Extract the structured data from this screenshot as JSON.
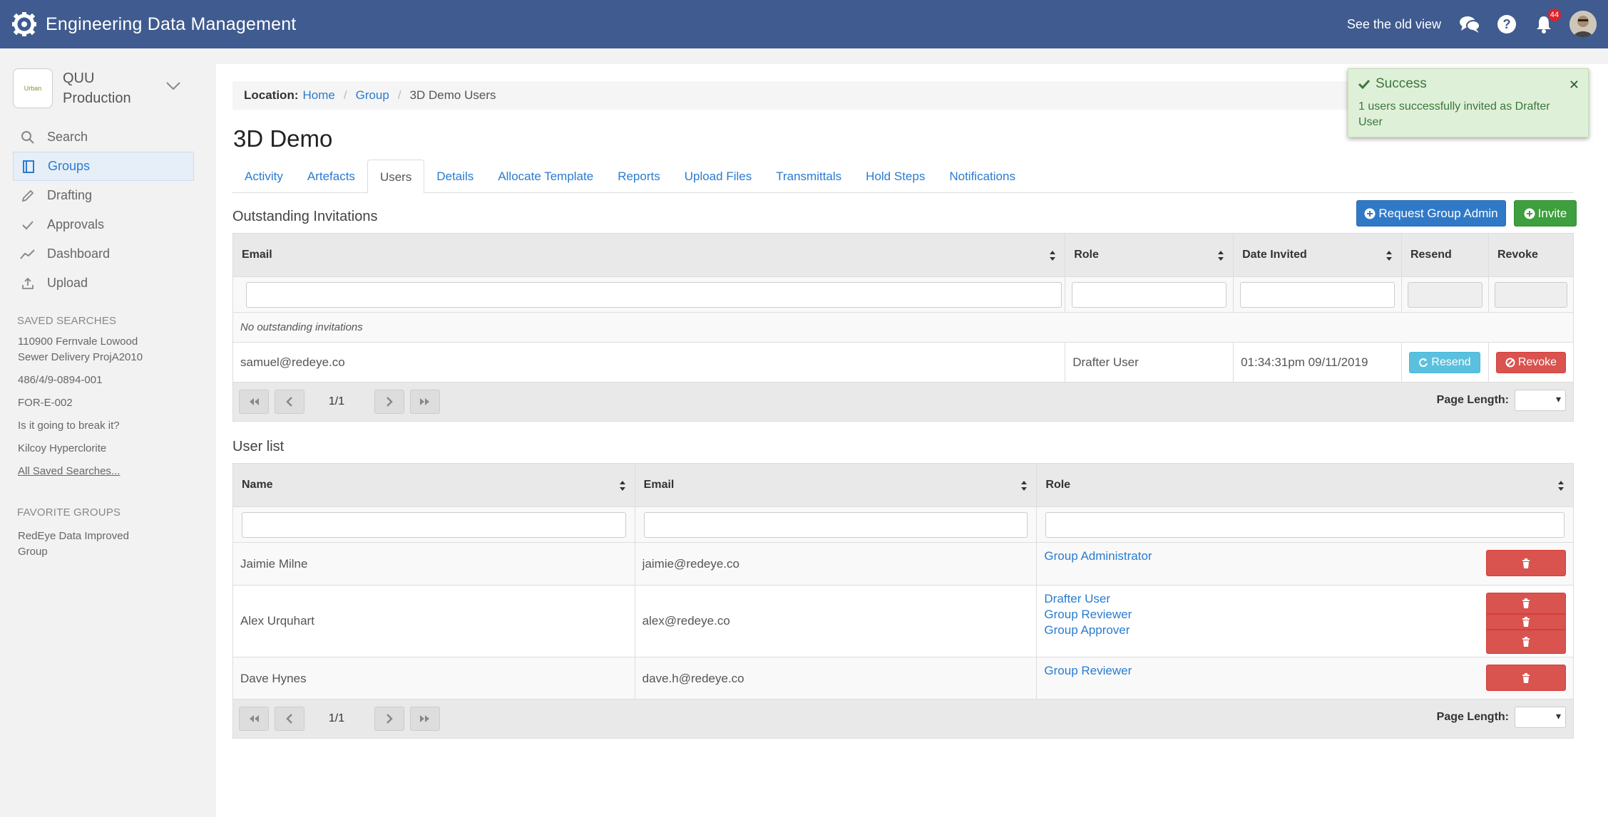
{
  "topbar": {
    "title": "Engineering Data Management",
    "old_view": "See the old view",
    "notifications_count": "44"
  },
  "sidebar": {
    "org_logo_text": "Urban",
    "org_name_line1": "QUU",
    "org_name_line2": "Production",
    "nav": [
      {
        "label": "Search",
        "icon": "search-icon"
      },
      {
        "label": "Groups",
        "icon": "book-icon"
      },
      {
        "label": "Drafting",
        "icon": "pencil-icon"
      },
      {
        "label": "Approvals",
        "icon": "check-icon"
      },
      {
        "label": "Dashboard",
        "icon": "chart-line-icon"
      },
      {
        "label": "Upload",
        "icon": "upload-icon"
      }
    ],
    "saved_searches_heading": "SAVED SEARCHES",
    "saved_searches": [
      "110900 Fernvale Lowood Sewer Delivery ProjA2010",
      "486/4/9-0894-001",
      "FOR-E-002",
      "Is it going to break it?",
      "Kilcoy Hyperclorite"
    ],
    "all_saved": "All Saved Searches...",
    "favorite_heading": "FAVORITE GROUPS",
    "favorite_groups": [
      "RedEye Data Improved Group"
    ]
  },
  "breadcrumb": {
    "label": "Location:",
    "items": [
      "Home",
      "Group"
    ],
    "current": "3D Demo Users"
  },
  "page_title": "3D Demo",
  "tabs": [
    "Activity",
    "Artefacts",
    "Users",
    "Details",
    "Allocate Template",
    "Reports",
    "Upload Files",
    "Transmittals",
    "Hold Steps",
    "Notifications"
  ],
  "invitations": {
    "title": "Outstanding Invitations",
    "request_admin_label": "Request Group Admin",
    "invite_label": "Invite",
    "columns": [
      "Email",
      "Role",
      "Date Invited",
      "Resend",
      "Revoke"
    ],
    "empty_text": "No outstanding invitations",
    "rows": [
      {
        "email": "samuel@redeye.co",
        "role": "Drafter User",
        "date": "01:34:31pm 09/11/2019",
        "resend": "Resend",
        "revoke": "Revoke"
      }
    ],
    "page": "1/1",
    "page_length_label": "Page Length:"
  },
  "users": {
    "title": "User list",
    "columns": [
      "Name",
      "Email",
      "Role"
    ],
    "rows": [
      {
        "name": "Jaimie Milne",
        "email": "jaimie@redeye.co",
        "roles": [
          "Group Administrator"
        ]
      },
      {
        "name": "Alex Urquhart",
        "email": "alex@redeye.co",
        "roles": [
          "Drafter User",
          "Group Reviewer",
          "Group Approver"
        ]
      },
      {
        "name": "Dave Hynes",
        "email": "dave.h@redeye.co",
        "roles": [
          "Group Reviewer"
        ]
      }
    ],
    "page": "1/1",
    "page_length_label": "Page Length:"
  },
  "toast": {
    "title": "Success",
    "message": "1 users successfully invited as Drafter User"
  },
  "colors": {
    "topbar": "#3f5b8f",
    "link": "#2a7bd0",
    "danger": "#d9534f",
    "success": "#3d9f3d",
    "info": "#5bc0de"
  }
}
